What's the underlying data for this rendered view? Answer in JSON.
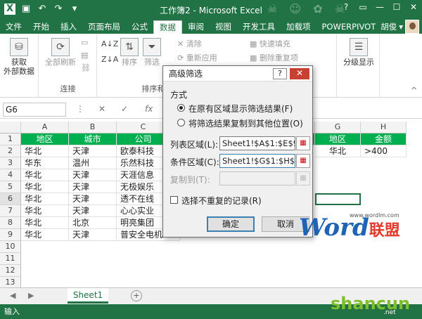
{
  "title": "工作簿2 - Microsoft Excel",
  "tabs": [
    "文件",
    "开始",
    "插入",
    "页面布局",
    "公式",
    "数据",
    "审阅",
    "视图",
    "开发工具",
    "加载项",
    "POWERPIVOT"
  ],
  "user": "胡俊",
  "ribbon": {
    "get_external": "获取\n外部数据",
    "refresh_all": "全部刷新",
    "group_connect": "连接",
    "sort": "排序",
    "filter": "筛选",
    "clear": "清除",
    "reapply": "重新应用",
    "group_sort_filter": "排序和",
    "flash_fill": "快速填充",
    "remove_dup": "删除重复项",
    "outline": "分级显示"
  },
  "formula": {
    "namebox": "G6",
    "fx": "fx"
  },
  "columns": [
    "A",
    "B",
    "C",
    "D",
    "E",
    "F",
    "G",
    "H"
  ],
  "rows": [
    "1",
    "2",
    "3",
    "4",
    "5",
    "6",
    "7",
    "8",
    "9",
    "10",
    "11",
    "12",
    "13"
  ],
  "table": {
    "header": [
      "地区",
      "城市",
      "公司"
    ],
    "data": [
      [
        "华北",
        "天津",
        "欧泰科技"
      ],
      [
        "华东",
        "温州",
        "乐然科技"
      ],
      [
        "华北",
        "天津",
        "天涯信息"
      ],
      [
        "华北",
        "天津",
        "无极娱乐"
      ],
      [
        "华北",
        "天津",
        "透不在线"
      ],
      [
        "华北",
        "天津",
        "心心实业"
      ],
      [
        "华北",
        "北京",
        "明亮集团"
      ],
      [
        "华北",
        "天津",
        "普安全电机"
      ]
    ]
  },
  "criteria": {
    "header": [
      "地区",
      "金额"
    ],
    "row": [
      "华北",
      ">400"
    ]
  },
  "dialog": {
    "title": "高级筛选",
    "help": "?",
    "close": "✕",
    "method_label": "方式",
    "opt1": "在原有区域显示筛选结果(F)",
    "opt2": "将筛选结果复制到其他位置(O)",
    "list_label": "列表区域(L):",
    "list_value": "Sheet1!$A$1:$E$9",
    "crit_label": "条件区域(C):",
    "crit_value": "Sheet1!$G$1:$H$2",
    "copy_label": "复制到(T):",
    "copy_value": "",
    "unique_label": "选择不重复的记录(R)",
    "ok": "确定",
    "cancel": "取消"
  },
  "sheet": "Sheet1",
  "status": "输入",
  "watermark": {
    "word": "Word",
    "lianmeng": "联盟",
    "site": "www.wordlm.com",
    "shancun": "shancun",
    "shancun_sub": ".net"
  }
}
